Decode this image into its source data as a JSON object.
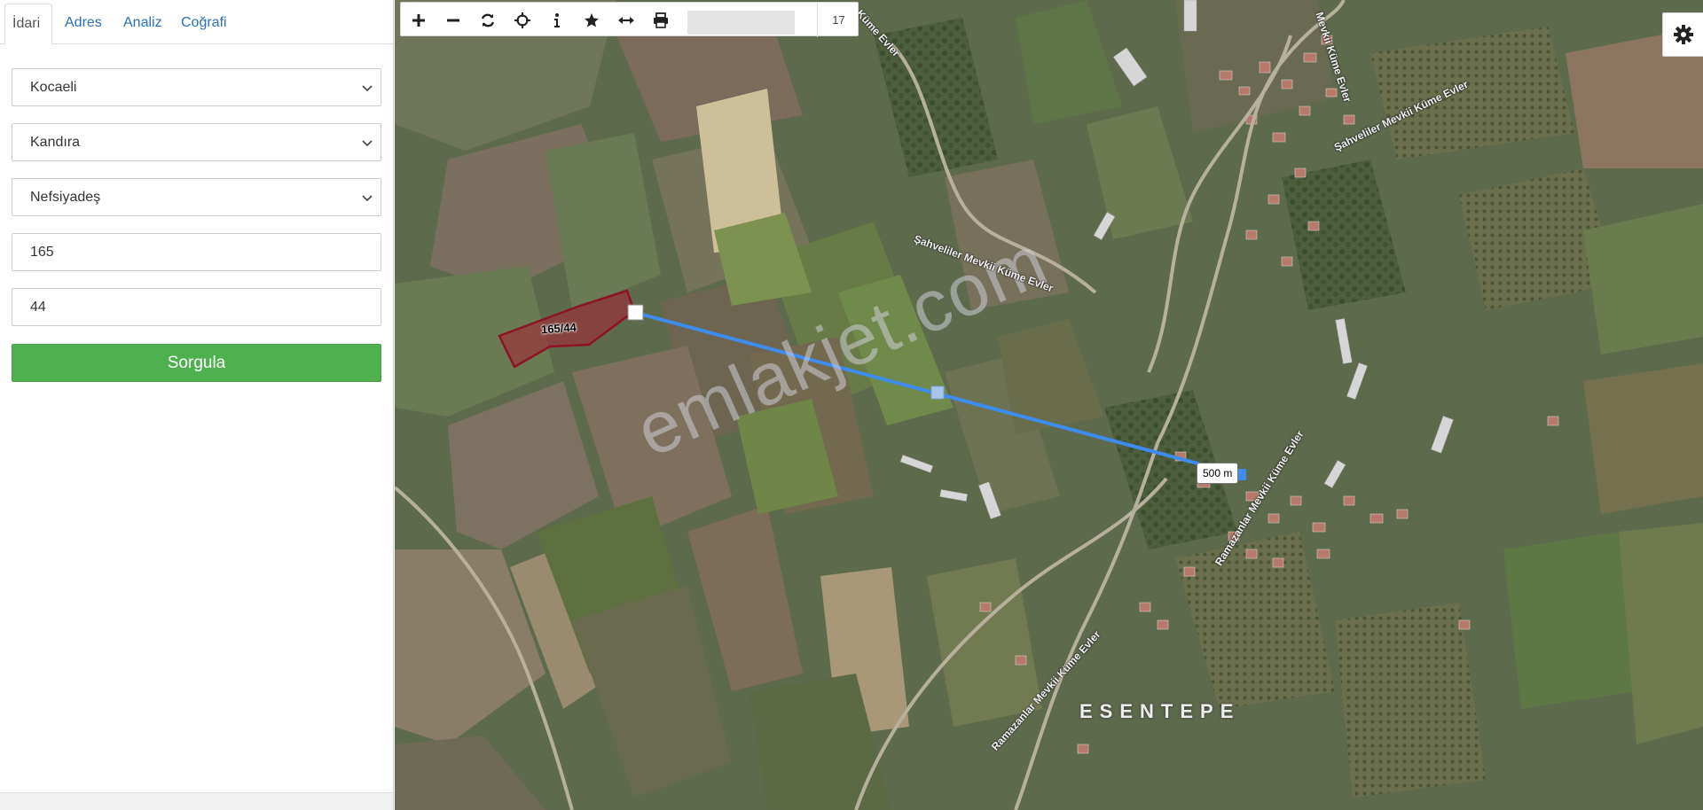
{
  "sidebar": {
    "tabs": [
      {
        "label": "İdari",
        "active": true
      },
      {
        "label": "Adres",
        "active": false
      },
      {
        "label": "Analiz",
        "active": false
      },
      {
        "label": "Coğrafi",
        "active": false
      }
    ],
    "il": "Kocaeli",
    "ilce": "Kandıra",
    "mahalle": "Nefsiyadeş",
    "ada": "165",
    "parsel": "44",
    "query_button": "Sorgula"
  },
  "map": {
    "toolbar": {
      "icons": [
        "zoom-in-icon",
        "zoom-out-icon",
        "refresh-icon",
        "crosshair-icon",
        "info-icon",
        "star-icon",
        "measure-icon",
        "print-icon"
      ],
      "zoom_level": "17"
    },
    "parcel_label": "165/44",
    "distance_label": "500 m",
    "watermark": "emlakjet.com",
    "village_label": "ESENTEPE",
    "road_labels": {
      "sahveliler": "Şahveliler Mevkii Küme Evler",
      "sahveliler2": "Şahveliler Mevkii Küme Evler",
      "ramazanlar1": "Ramazanlar Mevkii Küme Evler",
      "ramazanlar2": "Ramazanlar Mevkii Küme Evler",
      "top1": "Mevkii Küme Evler",
      "top2": "Küme Evler"
    },
    "colors": {
      "measure_line": "#3f8cf0",
      "parcel_fill": "#a52034",
      "query_button": "#4fb04f",
      "tab_link": "#2a6fb0"
    }
  }
}
